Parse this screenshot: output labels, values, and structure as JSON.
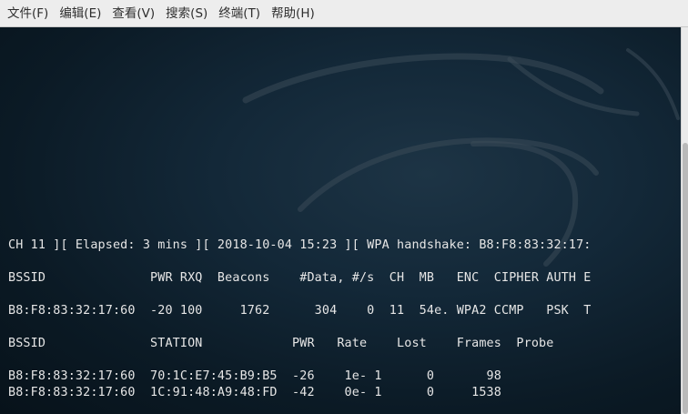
{
  "menubar": {
    "items": [
      "文件(F)",
      "编辑(E)",
      "查看(V)",
      "搜索(S)",
      "终端(T)",
      "帮助(H)"
    ]
  },
  "terminal": {
    "status_line": "CH 11 ][ Elapsed: 3 mins ][ 2018-10-04 15:23 ][ WPA handshake: B8:F8:83:32:17:",
    "ap_header": "BSSID              PWR RXQ  Beacons    #Data, #/s  CH  MB   ENC  CIPHER AUTH E",
    "ap_row": "B8:F8:83:32:17:60  -20 100     1762      304    0  11  54e. WPA2 CCMP   PSK  T",
    "station_header": "BSSID              STATION            PWR   Rate    Lost    Frames  Probe",
    "station_rows": [
      "B8:F8:83:32:17:60  70:1C:E7:45:B9:B5  -26    1e- 1      0       98",
      "B8:F8:83:32:17:60  1C:91:48:A9:48:FD  -42    0e- 1      0     1538"
    ]
  }
}
